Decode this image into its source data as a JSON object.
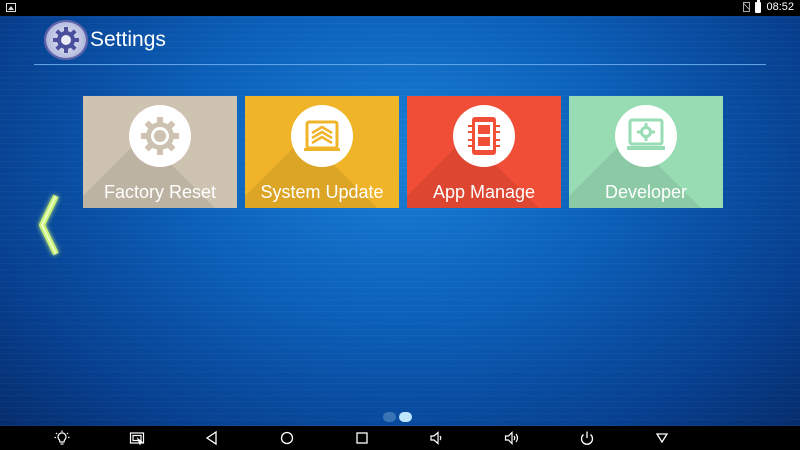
{
  "status_bar": {
    "time": "08:52"
  },
  "header": {
    "title": "Settings"
  },
  "tiles": [
    {
      "label": "Factory Reset",
      "color": "#cdc3b0",
      "icon": "gear-icon"
    },
    {
      "label": "System Update",
      "color": "#f0b429",
      "icon": "layers-icon"
    },
    {
      "label": "App Manage",
      "color": "#f04e37",
      "icon": "phone-apps-icon"
    },
    {
      "label": "Developer",
      "color": "#98dcb4",
      "icon": "monitor-gear-icon"
    }
  ],
  "pager": {
    "pages": 2,
    "current": 2
  },
  "nav_bar": {
    "buttons": [
      "brightness-icon",
      "screenshot-icon",
      "back-icon",
      "home-icon",
      "recents-icon",
      "volume-down-icon",
      "volume-up-icon",
      "power-icon",
      "hide-bar-icon"
    ]
  },
  "colors": {
    "background": "#0b5fb8",
    "accent_arrow": "#c8f07a"
  }
}
